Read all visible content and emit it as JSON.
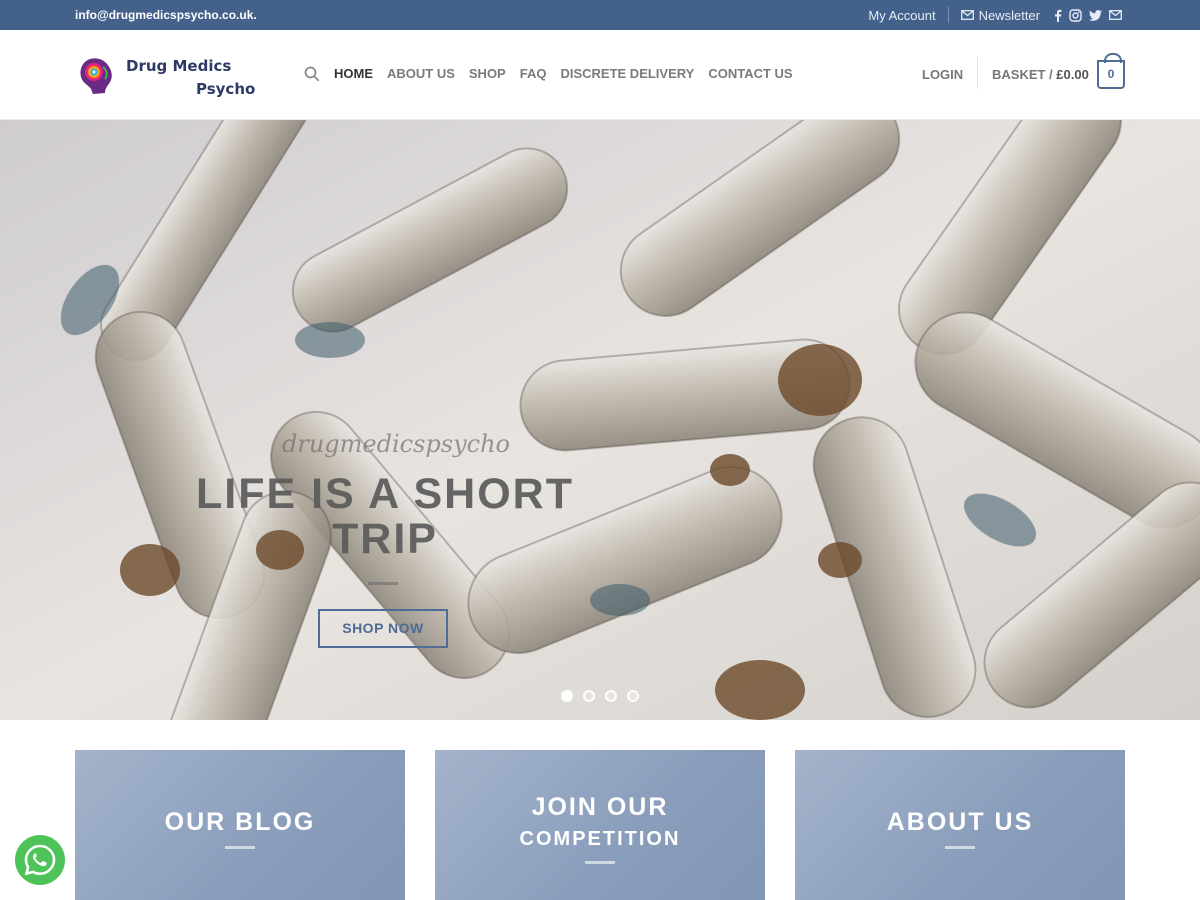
{
  "topbar": {
    "email": "info@drugmedicspsycho.co.uk.",
    "my_account": "My Account",
    "newsletter": "Newsletter",
    "social_icons": [
      "facebook-icon",
      "instagram-icon",
      "twitter-icon",
      "mail-icon"
    ]
  },
  "header": {
    "logo_line1": "Drug Medics",
    "logo_line2": "Psycho",
    "nav": [
      {
        "label": "HOME",
        "active": true
      },
      {
        "label": "ABOUT US"
      },
      {
        "label": "SHOP"
      },
      {
        "label": "FAQ"
      },
      {
        "label": "DISCRETE DELIVERY"
      },
      {
        "label": "CONTACT US"
      }
    ],
    "login": "LOGIN",
    "basket_label": "BASKET / ",
    "basket_amount": "£0.00",
    "cart_count": "0"
  },
  "hero": {
    "script_text": "drugmedicspsycho",
    "headline": "LIFE IS A SHORT TRIP",
    "button": "SHOP NOW",
    "slides_total": 4,
    "slide_active": 1
  },
  "cards": [
    {
      "title": "OUR BLOG",
      "subtitle": ""
    },
    {
      "title": "JOIN OUR",
      "subtitle": "COMPETITION"
    },
    {
      "title": "ABOUT US",
      "subtitle": ""
    }
  ],
  "colors": {
    "topbar": "#44618b",
    "accent": "#4f6c95",
    "whatsapp": "#4dc35a"
  }
}
